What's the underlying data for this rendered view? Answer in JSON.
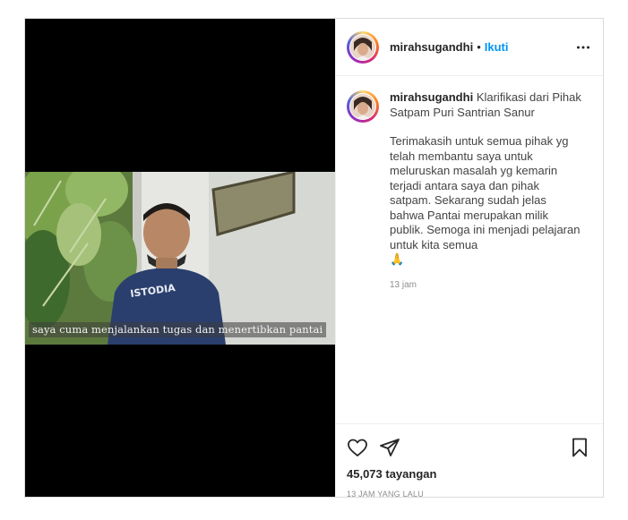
{
  "post": {
    "media": {
      "subtitle": "saya cuma menjalankan tugas dan menertibkan pantai",
      "shirt_text": "ISTODIA"
    },
    "header": {
      "username": "mirahsugandhi",
      "separator": "•",
      "follow_label": "Ikuti",
      "more_icon": "more-horizontal-icon"
    },
    "caption": {
      "username": "mirahsugandhi",
      "title": "Klarifikasi dari Pihak Satpam Puri Santrian Sanur",
      "text": "Terimakasih untuk semua pihak yg telah membantu saya untuk meluruskan masalah yg kemarin terjadi antara saya dan pihak satpam. Sekarang sudah jelas bahwa Pantai merupakan milik publik. Semoga ini menjadi pelajaran untuk kita semua",
      "emoji": "🙏",
      "time": "13 jam"
    },
    "actions": {
      "like_icon": "heart-icon",
      "share_icon": "send-icon",
      "save_icon": "bookmark-icon"
    },
    "views": "45,073 tayangan",
    "posted_ago": "13 JAM YANG LALU"
  },
  "colors": {
    "link": "#0095f6",
    "muted": "#8e8e8e",
    "border": "#dbdbdb"
  }
}
